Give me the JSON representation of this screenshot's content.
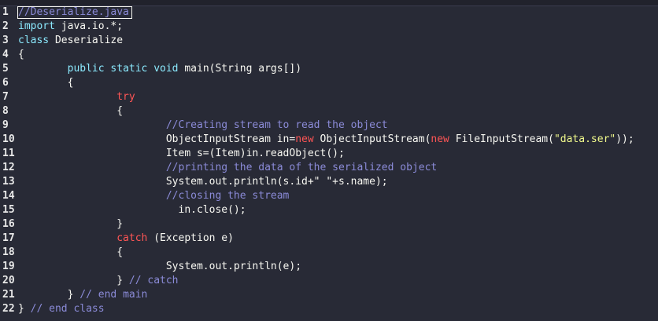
{
  "editor": {
    "language": "java",
    "lines": [
      {
        "num": "1",
        "segments": [
          {
            "text": "//Deserialize.java",
            "class": "tok-comment"
          }
        ]
      },
      {
        "num": "2",
        "segments": [
          {
            "text": "import",
            "class": "tok-keyword"
          },
          {
            "text": " java.io.*;",
            "class": "tok-plain"
          }
        ]
      },
      {
        "num": "3",
        "segments": [
          {
            "text": "class",
            "class": "tok-keyword"
          },
          {
            "text": " Deserialize",
            "class": "tok-plain"
          }
        ]
      },
      {
        "num": "4",
        "segments": [
          {
            "text": "{",
            "class": "tok-plain"
          }
        ]
      },
      {
        "num": "5",
        "segments": [
          {
            "text": "        ",
            "class": "tok-plain"
          },
          {
            "text": "public static void",
            "class": "tok-keyword"
          },
          {
            "text": " main(String args[])",
            "class": "tok-plain"
          }
        ]
      },
      {
        "num": "6",
        "segments": [
          {
            "text": "        {",
            "class": "tok-plain"
          }
        ]
      },
      {
        "num": "7",
        "segments": [
          {
            "text": "                ",
            "class": "tok-plain"
          },
          {
            "text": "try",
            "class": "tok-red"
          }
        ]
      },
      {
        "num": "8",
        "segments": [
          {
            "text": "                {",
            "class": "tok-plain"
          }
        ]
      },
      {
        "num": "9",
        "segments": [
          {
            "text": "                        ",
            "class": "tok-plain"
          },
          {
            "text": "//Creating stream to read the object",
            "class": "tok-comment"
          }
        ]
      },
      {
        "num": "10",
        "segments": [
          {
            "text": "                        ObjectInputStream in=",
            "class": "tok-plain"
          },
          {
            "text": "new",
            "class": "tok-red"
          },
          {
            "text": " ObjectInputStream(",
            "class": "tok-plain"
          },
          {
            "text": "new",
            "class": "tok-red"
          },
          {
            "text": " FileInputStream(",
            "class": "tok-plain"
          },
          {
            "text": "\"data.ser\"",
            "class": "tok-string"
          },
          {
            "text": "));",
            "class": "tok-plain"
          }
        ]
      },
      {
        "num": "11",
        "segments": [
          {
            "text": "                        Item s=(Item)in.readObject();",
            "class": "tok-plain"
          }
        ]
      },
      {
        "num": "12",
        "segments": [
          {
            "text": "                        ",
            "class": "tok-plain"
          },
          {
            "text": "//printing the data of the serialized object",
            "class": "tok-comment"
          }
        ]
      },
      {
        "num": "13",
        "segments": [
          {
            "text": "                        System.out.println(s.id+\" \"+s.name);",
            "class": "tok-plain"
          }
        ]
      },
      {
        "num": "14",
        "segments": [
          {
            "text": "                        ",
            "class": "tok-plain"
          },
          {
            "text": "//closing the stream",
            "class": "tok-comment"
          }
        ]
      },
      {
        "num": "15",
        "segments": [
          {
            "text": "                          in.close();",
            "class": "tok-plain"
          }
        ]
      },
      {
        "num": "16",
        "segments": [
          {
            "text": "                }",
            "class": "tok-plain"
          }
        ]
      },
      {
        "num": "17",
        "segments": [
          {
            "text": "                ",
            "class": "tok-plain"
          },
          {
            "text": "catch",
            "class": "tok-red"
          },
          {
            "text": " (Exception e)",
            "class": "tok-plain"
          }
        ]
      },
      {
        "num": "18",
        "segments": [
          {
            "text": "                {",
            "class": "tok-plain"
          }
        ]
      },
      {
        "num": "19",
        "segments": [
          {
            "text": "                        System.out.println(e);",
            "class": "tok-plain"
          }
        ]
      },
      {
        "num": "20",
        "segments": [
          {
            "text": "                } ",
            "class": "tok-plain"
          },
          {
            "text": "// catch",
            "class": "tok-comment"
          }
        ]
      },
      {
        "num": "21",
        "segments": [
          {
            "text": "        } ",
            "class": "tok-plain"
          },
          {
            "text": "// end main",
            "class": "tok-comment"
          }
        ]
      },
      {
        "num": "22",
        "segments": [
          {
            "text": "} ",
            "class": "tok-plain"
          },
          {
            "text": "// end class",
            "class": "tok-comment"
          }
        ]
      }
    ]
  },
  "colors": {
    "background": "#282a36",
    "comment": "#8b8bd8",
    "keyword": "#8be9fd",
    "red_keyword": "#ff5555",
    "string": "#f1fa8c",
    "text": "#f8f8f2"
  }
}
